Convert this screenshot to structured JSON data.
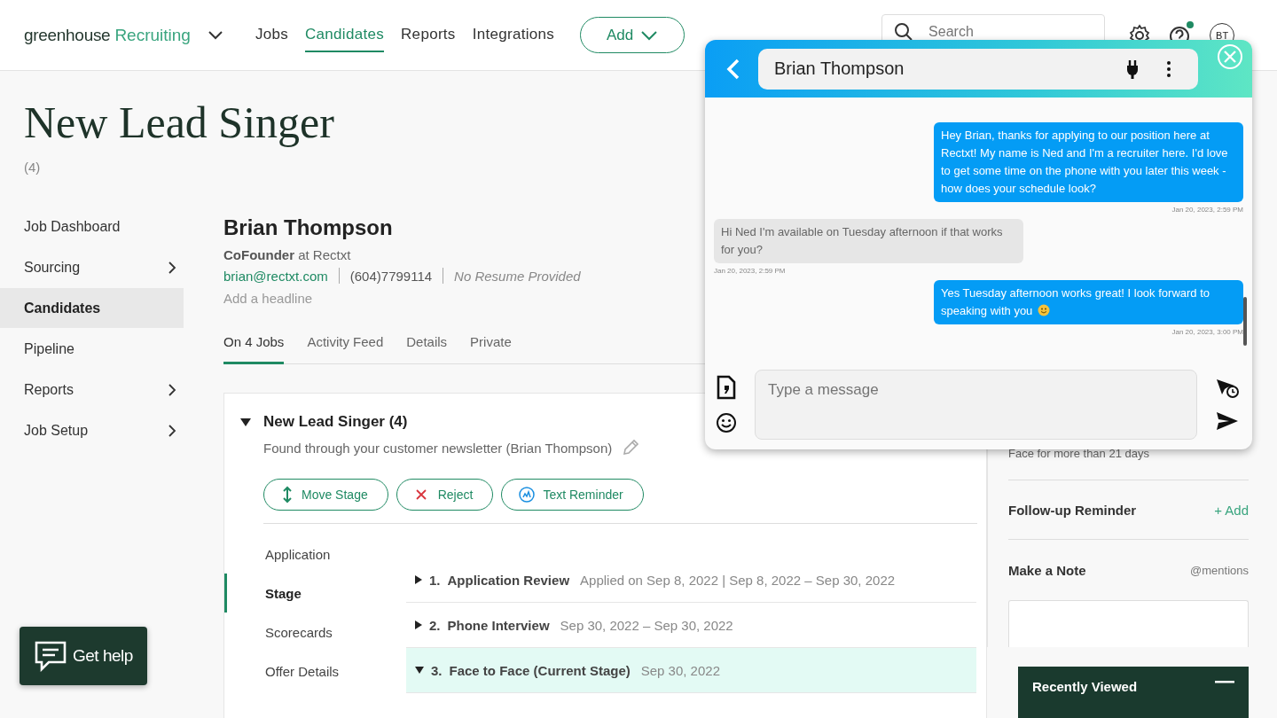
{
  "header": {
    "logo_main": "greenhouse",
    "logo_product": "Recruiting",
    "nav": [
      {
        "label": "Jobs",
        "selected": false
      },
      {
        "label": "Candidates",
        "selected": true
      },
      {
        "label": "Reports",
        "selected": false
      },
      {
        "label": "Integrations",
        "selected": false
      }
    ],
    "add_button": "Add",
    "search": {
      "placeholder": "Search"
    },
    "help_notification": true,
    "avatar": "BT"
  },
  "job": {
    "title": "New Lead Singer",
    "count": "(4)"
  },
  "sidebar": {
    "items": [
      {
        "label": "Job Dashboard",
        "selected": false,
        "has_submenu": false
      },
      {
        "label": "Sourcing",
        "selected": false,
        "has_submenu": true
      },
      {
        "label": "Candidates",
        "selected": true,
        "has_submenu": false
      },
      {
        "label": "Pipeline",
        "selected": false,
        "has_submenu": false
      },
      {
        "label": "Reports",
        "selected": false,
        "has_submenu": true
      },
      {
        "label": "Job Setup",
        "selected": false,
        "has_submenu": true
      }
    ]
  },
  "candidate": {
    "name": "Brian Thompson",
    "position": "**CoFounder** at Rectxt",
    "email": "brian@rectxt.com",
    "phone": "(604)7799114",
    "resume": "No Resume Provided",
    "headline_placeholder": "Add a headline"
  },
  "tabs": [
    {
      "label": "On 4 Jobs",
      "selected": true
    },
    {
      "label": "Activity Feed",
      "selected": false
    },
    {
      "label": "Details",
      "selected": false
    },
    {
      "label": "Private",
      "selected": false
    }
  ],
  "job_card": {
    "title": "New Lead Singer (4)",
    "expanded": true,
    "source": "Found through your customer newsletter (Brian Thompson)",
    "actions": [
      {
        "kind": "move",
        "label": "Move Stage"
      },
      {
        "kind": "reject",
        "label": "Reject"
      },
      {
        "kind": "reminder",
        "label": "Text Reminder"
      }
    ],
    "sections": [
      {
        "label": "Application",
        "selected": false
      },
      {
        "label": "Stage",
        "selected": true
      },
      {
        "label": "Scorecards",
        "selected": false
      },
      {
        "label": "Offer Details",
        "selected": false
      }
    ],
    "stages": [
      {
        "number": "1.",
        "name": "Application Review",
        "dates": "Applied on Sep 8, 2022 | Sep 8, 2022 – Sep 30, 2022",
        "expanded": false,
        "current": false
      },
      {
        "number": "2.",
        "name": "Phone Interview",
        "dates": "Sep 30, 2022 – Sep 30, 2022",
        "expanded": false,
        "current": false
      },
      {
        "number": "3.",
        "name": "Face to Face (Current Stage)",
        "dates": "Sep 30, 2022",
        "expanded": true,
        "current": true
      }
    ]
  },
  "right_panel": {
    "stage_note": "Face for more than 21 days",
    "reminder": {
      "title": "Follow-up Reminder",
      "action": "+ Add"
    },
    "note": {
      "title": "Make a Note",
      "hint": "@mentions"
    }
  },
  "chat": {
    "contact": "Brian Thompson",
    "messages": [
      {
        "kind": "outgoing",
        "text": "Hey Brian, thanks for applying to our position here at Rectxt! My name is Ned and I'm a recruiter here. I'd love to get some time on the phone with you later this week - how does your schedule look?",
        "time": "Jan 20, 2023, 2:59 PM",
        "emoji": false
      },
      {
        "kind": "incoming",
        "text": "Hi Ned I'm available on Tuesday afternoon if that works for you?",
        "time": "Jan 20, 2023, 2:59 PM",
        "emoji": false
      },
      {
        "kind": "outgoing",
        "text": "Yes Tuesday afternoon works great! I look forward to speaking with you",
        "time": "Jan 20, 2023, 3:00 PM",
        "emoji": true
      }
    ],
    "composer": {
      "placeholder": "Type a message"
    }
  },
  "help_button": "Get help",
  "recently_viewed": {
    "title": "Recently Viewed"
  }
}
